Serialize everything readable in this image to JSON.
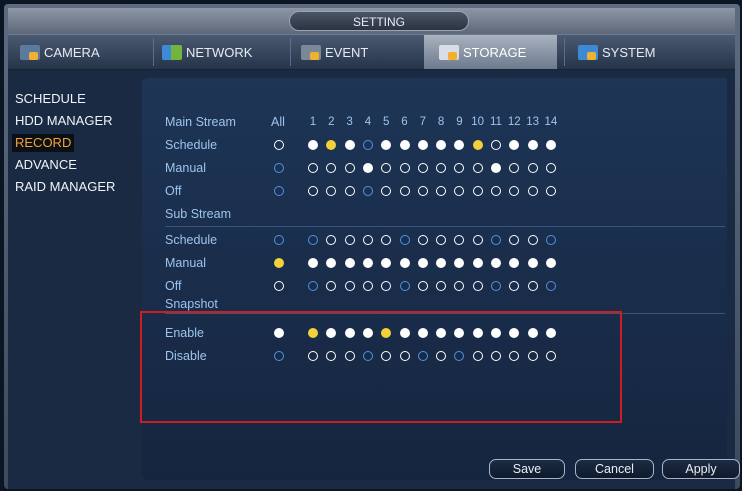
{
  "window": {
    "title": "SETTING"
  },
  "tabs": [
    {
      "label": "CAMERA",
      "icon": "camera-settings-icon"
    },
    {
      "label": "NETWORK",
      "icon": "network-icon"
    },
    {
      "label": "EVENT",
      "icon": "event-icon"
    },
    {
      "label": "STORAGE",
      "icon": "storage-icon",
      "active": true
    },
    {
      "label": "SYSTEM",
      "icon": "system-icon"
    }
  ],
  "sidebar": {
    "items": [
      {
        "label": "SCHEDULE"
      },
      {
        "label": "HDD MANAGER"
      },
      {
        "label": "RECORD",
        "active": true
      },
      {
        "label": "ADVANCE"
      },
      {
        "label": "RAID MANAGER"
      }
    ]
  },
  "record": {
    "all_label": "All",
    "channels": [
      "1",
      "2",
      "3",
      "4",
      "5",
      "6",
      "7",
      "8",
      "9",
      "10",
      "11",
      "12",
      "13",
      "14"
    ],
    "sections": {
      "main": {
        "title": "Main Stream",
        "rows": [
          {
            "label": "Schedule",
            "all": "ow",
            "states": [
              "fw",
              "fy",
              "fw",
              "ob",
              "fw",
              "fw",
              "fw",
              "fw",
              "fw",
              "fy",
              "ow",
              "fw",
              "fw",
              "fw"
            ]
          },
          {
            "label": "Manual",
            "all": "ob",
            "states": [
              "ow",
              "ow",
              "ow",
              "fw",
              "ow",
              "ow",
              "ow",
              "ow",
              "ow",
              "ow",
              "fw",
              "ow",
              "ow",
              "ow"
            ]
          },
          {
            "label": "Off",
            "all": "ob",
            "states": [
              "ow",
              "ow",
              "ow",
              "ob",
              "ow",
              "ow",
              "ow",
              "ow",
              "ow",
              "ow",
              "ow",
              "ow",
              "ow",
              "ow"
            ]
          }
        ]
      },
      "sub": {
        "title": "Sub Stream",
        "rows": [
          {
            "label": "Schedule",
            "all": "ob",
            "states": [
              "ob",
              "ow",
              "ow",
              "ow",
              "ow",
              "ob",
              "ow",
              "ow",
              "ow",
              "ow",
              "ob",
              "ow",
              "ow",
              "ob"
            ]
          },
          {
            "label": "Manual",
            "all": "fy",
            "states": [
              "fw",
              "fw",
              "fw",
              "fw",
              "fw",
              "fw",
              "fw",
              "fw",
              "fw",
              "fw",
              "fw",
              "fw",
              "fw",
              "fw"
            ]
          },
          {
            "label": "Off",
            "all": "ow",
            "states": [
              "ob",
              "ow",
              "ow",
              "ow",
              "ow",
              "ob",
              "ow",
              "ow",
              "ow",
              "ow",
              "ob",
              "ow",
              "ow",
              "ob"
            ]
          }
        ]
      },
      "snapshot": {
        "title": "Snapshot",
        "rows": [
          {
            "label": "Enable",
            "all": "fw",
            "states": [
              "fy",
              "fw",
              "fw",
              "fw",
              "fy",
              "fw",
              "fw",
              "fw",
              "fw",
              "fw",
              "fw",
              "fw",
              "fw",
              "fw"
            ]
          },
          {
            "label": "Disable",
            "all": "ob",
            "states": [
              "ow",
              "ow",
              "ow",
              "ob",
              "ow",
              "ow",
              "ob",
              "ow",
              "ob",
              "ow",
              "ow",
              "ow",
              "ow",
              "ow"
            ]
          }
        ]
      }
    }
  },
  "buttons": {
    "save": "Save",
    "cancel": "Cancel",
    "apply": "Apply"
  },
  "colors": {
    "accent_active": "#f5a238",
    "label_blue": "#9ec4ee",
    "highlight_box": "#cf1c22",
    "dot_yellow": "#f3d13a"
  }
}
